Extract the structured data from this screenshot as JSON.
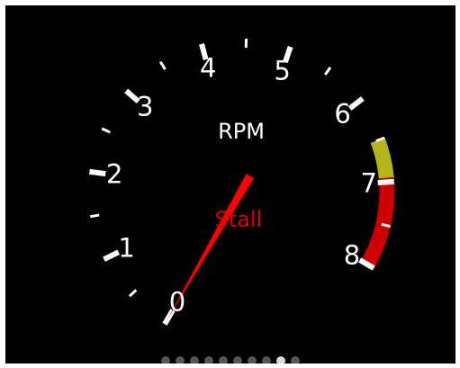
{
  "gauge": {
    "title": "RPM",
    "status": "Stall",
    "value": 0,
    "max": 8,
    "labels": [
      "0",
      "1",
      "2",
      "3",
      "4",
      "5",
      "6",
      "7",
      "8"
    ],
    "colors": {
      "background": "#000000",
      "ticks": "#ffffff",
      "needle": "#ff0000",
      "status": "#e00000",
      "zone_warning": "#b5b51a",
      "zone_redline": "#cc0000"
    }
  },
  "pager": {
    "count": 10,
    "active": 8
  }
}
